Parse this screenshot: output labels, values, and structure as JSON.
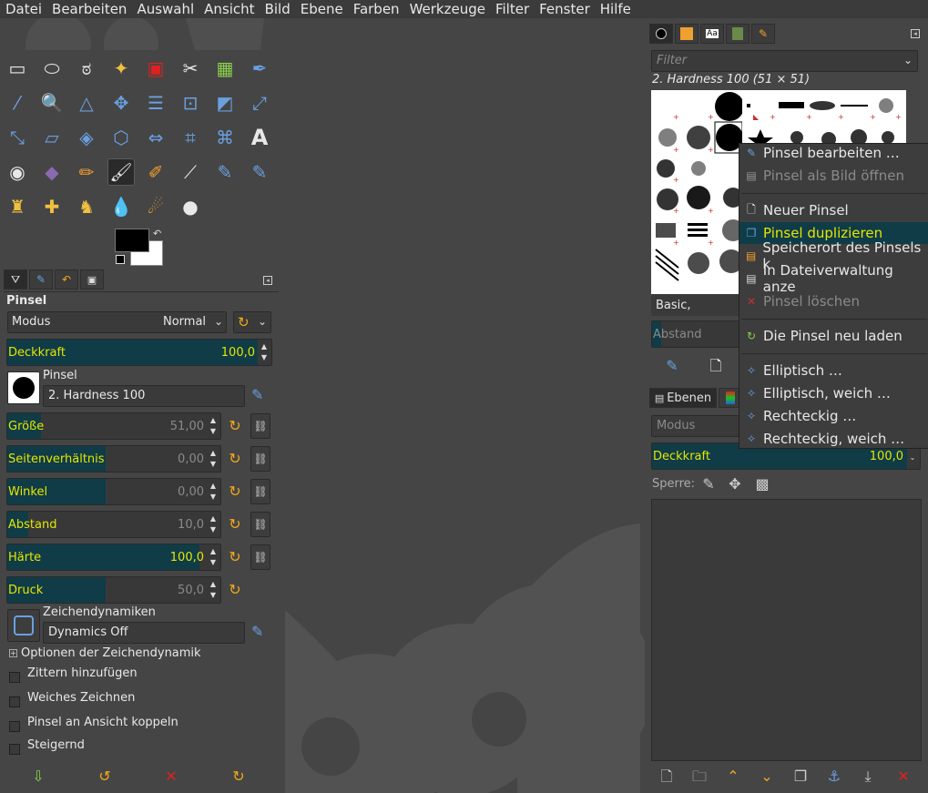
{
  "menu": [
    "Datei",
    "Bearbeiten",
    "Auswahl",
    "Ansicht",
    "Bild",
    "Ebene",
    "Farben",
    "Werkzeuge",
    "Filter",
    "Fenster",
    "Hilfe"
  ],
  "tool_options": {
    "title": "Pinsel",
    "mode_label": "Modus",
    "mode_value": "Normal",
    "opacity": {
      "label": "Deckkraft",
      "value": "100,0",
      "fraction": 0.94
    },
    "brush_label": "Pinsel",
    "brush_value": "2. Hardness 100",
    "sliders": [
      {
        "label": "Größe",
        "value": "51,00",
        "fraction": 0.16,
        "highlight": false
      },
      {
        "label": "Seitenverhältnis",
        "value": "0,00",
        "fraction": 0.46,
        "highlight": false
      },
      {
        "label": "Winkel",
        "value": "0,00",
        "fraction": 0.46,
        "highlight": false
      },
      {
        "label": "Abstand",
        "value": "10,0",
        "fraction": 0.1,
        "highlight": false
      },
      {
        "label": "Härte",
        "value": "100,0",
        "fraction": 0.9,
        "highlight": true
      },
      {
        "label": "Druck",
        "value": "50,0",
        "fraction": 0.46,
        "highlight": false
      }
    ],
    "dynamics_label": "Zeichendynamiken",
    "dynamics_value": "Dynamics Off",
    "dynamics_options": "Optionen der Zeichendynamik",
    "checkboxes": [
      "Zittern hinzufügen",
      "Weiches Zeichnen",
      "Pinsel an Ansicht koppeln",
      "Steigernd"
    ]
  },
  "brushes": {
    "filter_placeholder": "Filter",
    "selected": "2. Hardness 100 (51 × 51)",
    "tag": "Basic,",
    "spacing_label": "Abstand"
  },
  "context_menu": [
    {
      "label": "Pinsel bearbeiten …",
      "icon": "brush-edit-icon",
      "disabled": false,
      "selected": false
    },
    {
      "label": "Pinsel als Bild öffnen",
      "icon": "open-as-image-icon",
      "disabled": true,
      "selected": false
    },
    {
      "label": "Neuer Pinsel",
      "icon": "new-icon",
      "disabled": false,
      "selected": false
    },
    {
      "label": "Pinsel duplizieren",
      "icon": "duplicate-icon",
      "disabled": false,
      "selected": true
    },
    {
      "label": "Speicherort des Pinsels k",
      "icon": "copy-location-icon",
      "disabled": false,
      "selected": false
    },
    {
      "label": "In Dateiverwaltung anze",
      "icon": "file-manager-icon",
      "disabled": false,
      "selected": false
    },
    {
      "label": "Pinsel löschen",
      "icon": "delete-icon",
      "disabled": true,
      "selected": false
    },
    {
      "label": "Die Pinsel neu laden",
      "icon": "reload-icon",
      "disabled": false,
      "selected": false
    },
    {
      "label": "Elliptisch …",
      "icon": "generated-brush-icon",
      "disabled": false,
      "selected": false
    },
    {
      "label": "Elliptisch, weich …",
      "icon": "generated-brush-icon",
      "disabled": false,
      "selected": false
    },
    {
      "label": "Rechteckig …",
      "icon": "generated-brush-icon",
      "disabled": false,
      "selected": false
    },
    {
      "label": "Rechteckig, weich …",
      "icon": "generated-brush-icon",
      "disabled": false,
      "selected": false
    }
  ],
  "layers": {
    "tab": "Ebenen",
    "mode_label": "Modus",
    "opacity_label": "Deckkraft",
    "opacity_value": "100,0",
    "lock_label": "Sperre:"
  },
  "colors": {
    "accent_text": "#e6e600",
    "selection_bg": "#0f3c47",
    "reset_icon": "#f0a81a"
  }
}
